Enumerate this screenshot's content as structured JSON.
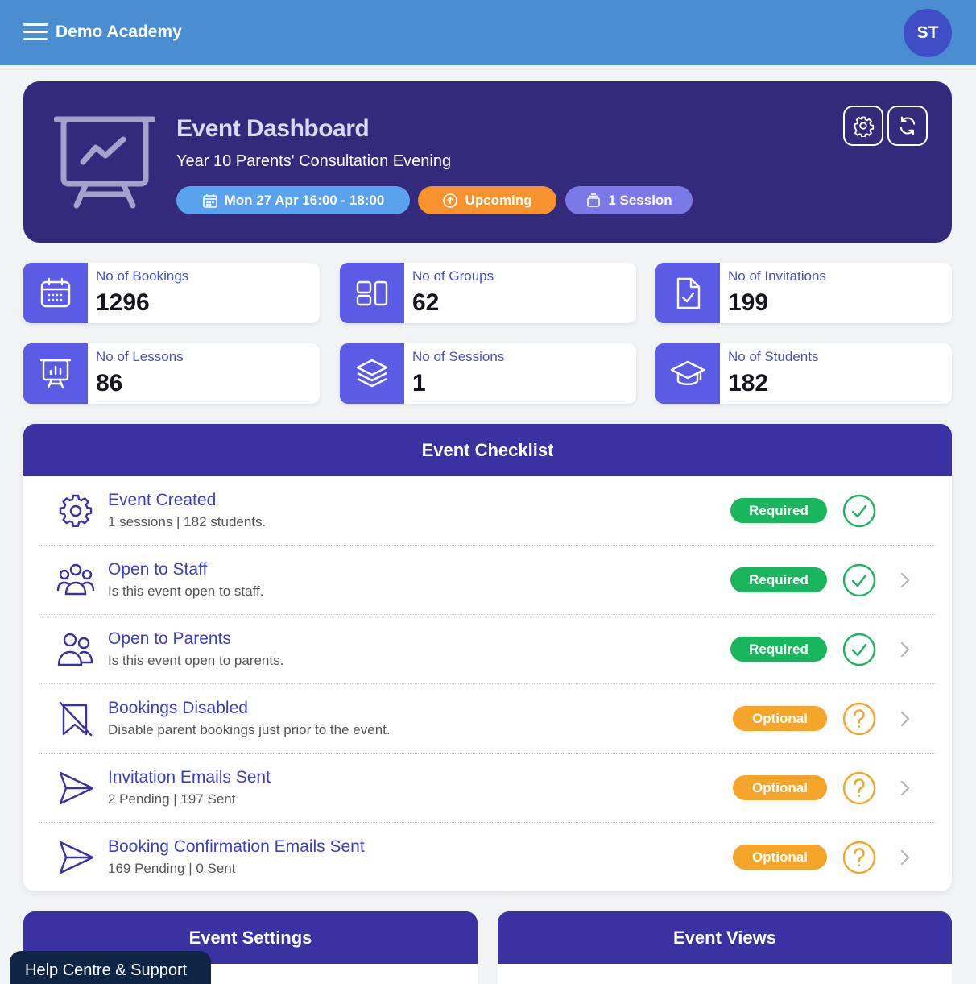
{
  "app": {
    "brand": "Demo Academy",
    "user_initials": "ST"
  },
  "hero": {
    "title": "Event Dashboard",
    "subtitle": "Year 10 Parents' Consultation Evening",
    "date_pill": "Mon 27 Apr 16:00 - 18:00",
    "status_pill": "Upcoming",
    "session_pill": "1 Session"
  },
  "stats": [
    {
      "label": "No of Bookings",
      "value": "1296",
      "icon": "calendar-icon"
    },
    {
      "label": "No of Groups",
      "value": "62",
      "icon": "groups-icon"
    },
    {
      "label": "No of Invitations",
      "value": "199",
      "icon": "document-check-icon"
    },
    {
      "label": "No of Lessons",
      "value": "86",
      "icon": "presentation-chart-icon"
    },
    {
      "label": "No of Sessions",
      "value": "1",
      "icon": "layers-icon"
    },
    {
      "label": "No of Students",
      "value": "182",
      "icon": "graduation-cap-icon"
    }
  ],
  "checklist": {
    "title": "Event Checklist",
    "items": [
      {
        "title": "Event Created",
        "desc": "1 sessions | 182 students.",
        "badge": "Required",
        "status": "complete"
      },
      {
        "title": "Open to Staff",
        "desc": "Is this event open to staff.",
        "badge": "Required",
        "status": "complete"
      },
      {
        "title": "Open to Parents",
        "desc": "Is this event open to parents.",
        "badge": "Required",
        "status": "complete"
      },
      {
        "title": "Bookings Disabled",
        "desc": "Disable parent bookings just prior to the event.",
        "badge": "Optional",
        "status": "unknown"
      },
      {
        "title": "Invitation Emails Sent",
        "desc": "2 Pending | 197 Sent",
        "badge": "Optional",
        "status": "unknown"
      },
      {
        "title": "Booking Confirmation Emails Sent",
        "desc": "169 Pending | 0 Sent",
        "badge": "Optional",
        "status": "unknown"
      }
    ]
  },
  "panels": {
    "settings_title": "Event Settings",
    "views_title": "Event Views"
  },
  "help": {
    "label": "Help Centre & Support"
  },
  "colors": {
    "topbar": "#4a8dd0",
    "hero": "#332a7c",
    "accent": "#5b5be6",
    "required": "#19b65e",
    "optional": "#f4a52a"
  }
}
